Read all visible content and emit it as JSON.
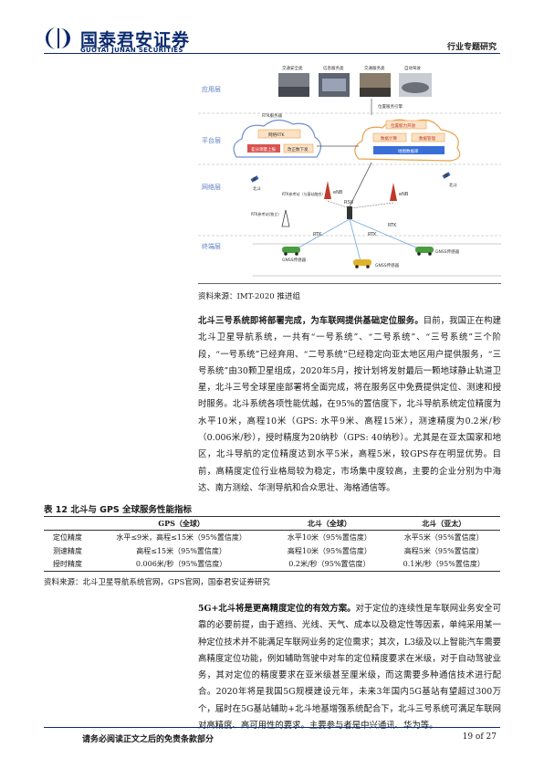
{
  "header": {
    "company_cn": "国泰君安证券",
    "company_en": "GUOTAI JUNAN SECURITIES",
    "report_type": "行业专题研究"
  },
  "figure": {
    "layers": {
      "application": "应用层",
      "platform": "平台层",
      "network": "网络层",
      "terminal": "终端层"
    },
    "apps": [
      "交通安全类",
      "信息服务类",
      "交通服务类",
      "自动驾驶"
    ],
    "location_engine": "位置服务引擎",
    "rtk_server": "RTK服务器",
    "network_rtk": "网络RTK",
    "data_upload": "差分测量上报",
    "correction_download": "改正数下发",
    "location_capability": "位置能力开放",
    "data_compute": "数据计算",
    "data_manage": "数据管理",
    "map_db": "地图数据库",
    "beidou": "北斗",
    "rtk_ref_station": "RTK参考站（与基站融合）",
    "rtk_ref_station_alone": "RTK参考站(独立)",
    "enb1": "eNB",
    "enb2": "eNB",
    "rsu": "RSU",
    "rtk_label": "RTK",
    "gnss_sensor": "GNSS传感器",
    "source": "资料来源：IMT-2020 推进组"
  },
  "para1": {
    "bold_lead": "北斗三号系统即将部署完成，为车联网提供基础定位服务。",
    "text": "目前，我国正在构建北斗卫星导航系统，一共有“一号系统”、“二号系统”、“三号系统”三个阶段，“一号系统”已经弃用、“二号系统”已经稳定向亚太地区用户提供服务，“三号系统”由30颗卫星组成，2020年5月，按计划将发射最后一颗地球静止轨道卫星，北斗三号全球星座部署将全面完成，将在服务区中免费提供定位、测速和授时服务。北斗系统各项性能优越，在95%的置信度下，北斗导航系统定位精度为水平10米，高程10米（GPS: 水平9米、高程15米），测速精度为0.2米/秒（0.006米/秒），授时精度为20纳秒（GPS: 40纳秒）。尤其是在亚太国家和地区，北斗导航的定位精度达到水平5米，高程5米，较GPS存在明显优势。目前，高精度定位行业格局较为稳定，市场集中度较高，主要的企业分别为中海达、南方测绘、华测导航和合众思壮、海格通信等。"
  },
  "table": {
    "title": "表 12 北斗与 GPS 全球服务性能指标",
    "headers": [
      "",
      "GPS（全球）",
      "北斗（全球）",
      "北斗（亚太）"
    ],
    "rows": [
      [
        "定位精度",
        "水平≤9米，高程≤15米（95%置信度）",
        "水平10米（95%置信度）",
        "水平5米（95%置信度）"
      ],
      [
        "测速精度",
        "高程≤15米（95%置信度）",
        "高程10米（95%置信度）",
        "高程5米（95%置信度）"
      ],
      [
        "授时精度",
        "0.006米/秒（95%置信度）",
        "0.2米/秒（95%置信度）",
        "0.1米/秒（95%置信度）"
      ]
    ],
    "source": "资料来源：北斗卫星导航系统官网，GPS官网，国泰君安证券研究"
  },
  "para2": {
    "bold_lead": "5G+北斗将是更高精度定位的有效方案。",
    "text": "对于定位的连续性是车联网业务安全可靠的必要前提，由于遮挡、光线、天气、成本以及稳定性等因素，单纯采用某一种定位技术并不能满足车联网业务的定位需求；其次，L3级及以上智能汽车需要高精度定位功能，例如辅助驾驶中对车的定位精度要求在米级，对于自动驾驶业务，其对定位的精度要求在亚米级甚至厘米级，而这需要多种通信技术进行配合。2020年将是我国5G规模建设元年，未来3年国内5G基站有望超过300万个，届时在5G基站辅助+北斗地基增强系统配合下，北斗三号系统可满足车联网对高精度、高可用性的要求。主要参与者是中兴通讯、华为等。"
  },
  "footer": {
    "disclaimer": "请务必阅读正文之后的免责条款部分",
    "page": "19 of 27"
  },
  "colors": {
    "brand_blue": "#0b2a6f",
    "layer_label": "#5b7fbf",
    "cloud_blue": "#6f8fcf",
    "cloud_orange": "#e8a24a",
    "box_red": "#d9534f"
  }
}
